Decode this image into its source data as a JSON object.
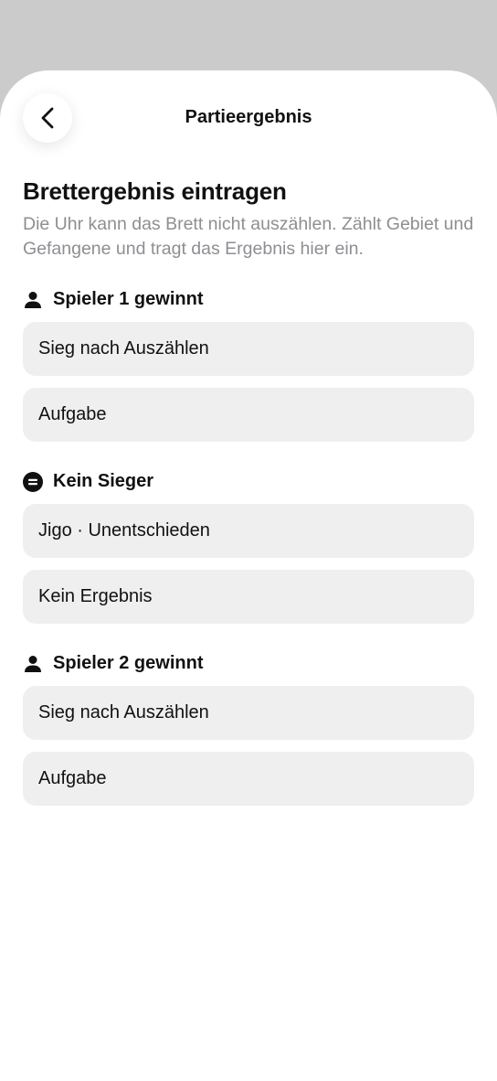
{
  "nav": {
    "title": "Partieergebnis",
    "back_icon": "chevron-left-icon"
  },
  "header": {
    "title": "Brettergebnis eintragen",
    "description": "Die Uhr kann das Brett nicht auszählen. Zählt Gebiet und Gefangene und tragt das Ergebnis hier ein."
  },
  "sections": [
    {
      "label": "Spieler 1 gewinnt",
      "icon": "person-icon",
      "options": [
        "Sieg nach Auszählen",
        "Aufgabe"
      ]
    },
    {
      "label": "Kein Sieger",
      "icon": "equals-circle-icon",
      "options": [
        "Jigo · Unentschieden",
        "Kein Ergebnis"
      ]
    },
    {
      "label": "Spieler 2 gewinnt",
      "icon": "person-icon",
      "options": [
        "Sieg nach Auszählen",
        "Aufgabe"
      ]
    }
  ],
  "colors": {
    "backdrop": "#cbcbcb",
    "sheet": "#ffffff",
    "option_bg": "#efefef",
    "secondary_text": "#8e8e93"
  }
}
